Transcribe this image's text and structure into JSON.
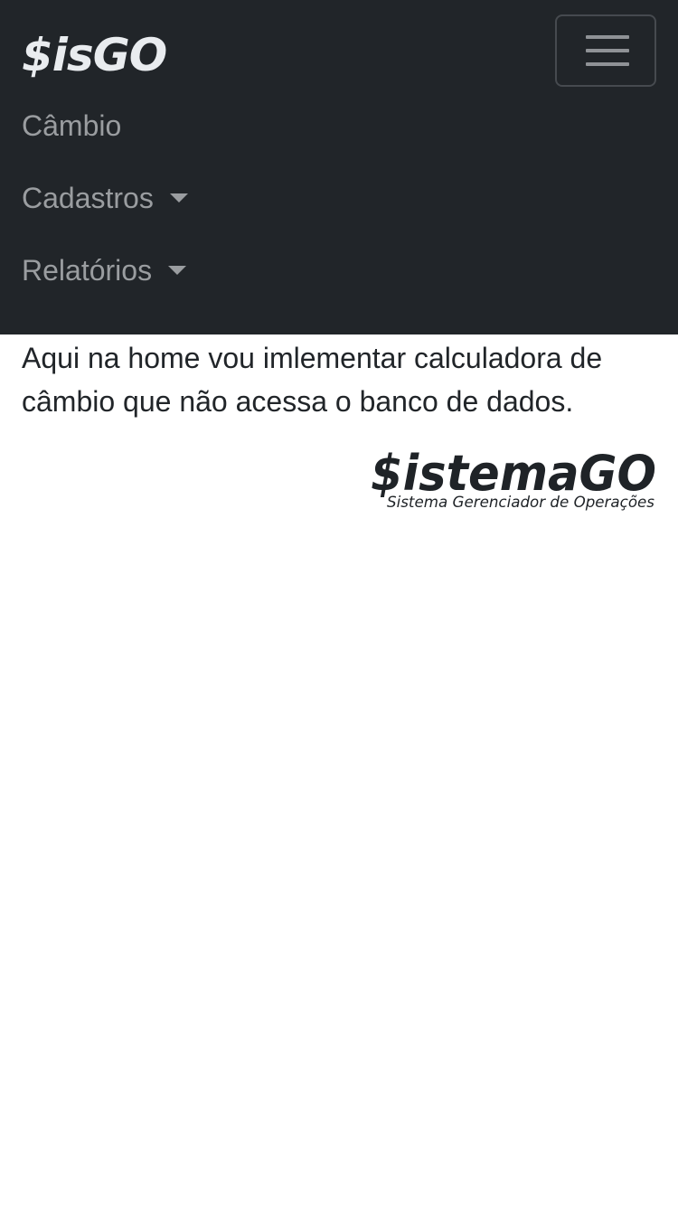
{
  "navbar": {
    "brand": "$isGO",
    "toggler_icon": "hamburger-menu-icon",
    "items": [
      {
        "label": "Câmbio",
        "has_dropdown": false
      },
      {
        "label": "Cadastros",
        "has_dropdown": true,
        "icon": "caret-down-icon"
      },
      {
        "label": "Relatórios",
        "has_dropdown": true,
        "icon": "caret-down-icon"
      }
    ]
  },
  "main": {
    "message": "Aqui na home vou imlementar calculadora de câmbio que não acessa o banco de dados."
  },
  "logo": {
    "title": "$istemaGO",
    "subtitle": "Sistema Gerenciador de Operações"
  },
  "colors": {
    "navbar_bg": "#212529",
    "nav_text": "#9a9da0",
    "brand_text": "#e9ecef",
    "body_text": "#212529",
    "logo_text": "#1f2327"
  }
}
